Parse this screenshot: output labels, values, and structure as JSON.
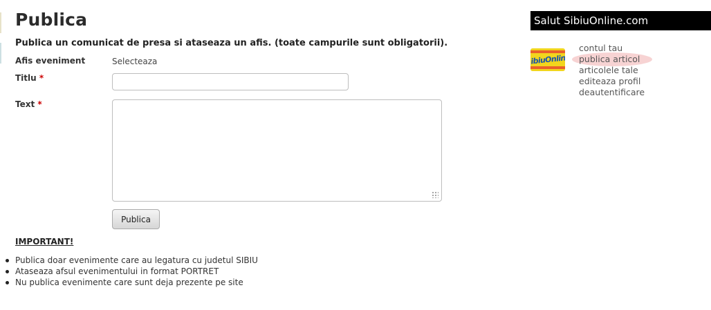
{
  "page": {
    "title": "Publica",
    "intro": "Publica un comunicat de presa si ataseaza un afis. (toate campurile sunt obligatorii)."
  },
  "form": {
    "afis_label": "Afis eveniment",
    "afis_select": "Selecteaza",
    "titlu_label": "Titlu",
    "text_label": "Text",
    "required_mark": "*",
    "titlu_value": "",
    "text_value": "",
    "submit_label": "Publica"
  },
  "notice": {
    "heading": "IMPORTANT!",
    "rules": [
      "Publica doar evenimente care au legatura cu judetul SIBIU",
      "Ataseaza afsul evenimentului in format PORTRET",
      "Nu publica evenimente care sunt deja prezente pe site"
    ]
  },
  "sidebar": {
    "greeting": "Salut SibiuOnline.com",
    "logo_text": "SibiuOnline",
    "menu": [
      {
        "label": "contul tau",
        "active": false
      },
      {
        "label": "publica articol",
        "active": true
      },
      {
        "label": "articolele tale",
        "active": false
      },
      {
        "label": "editeaza profil",
        "active": false
      },
      {
        "label": "deautentificare",
        "active": false
      }
    ]
  },
  "colors": {
    "required": "#cc0000",
    "greeting_bg": "#000000",
    "logo_bg": "#f2d51d",
    "logo_text": "#1c57a8",
    "active_highlight": "#f7d3d3"
  }
}
